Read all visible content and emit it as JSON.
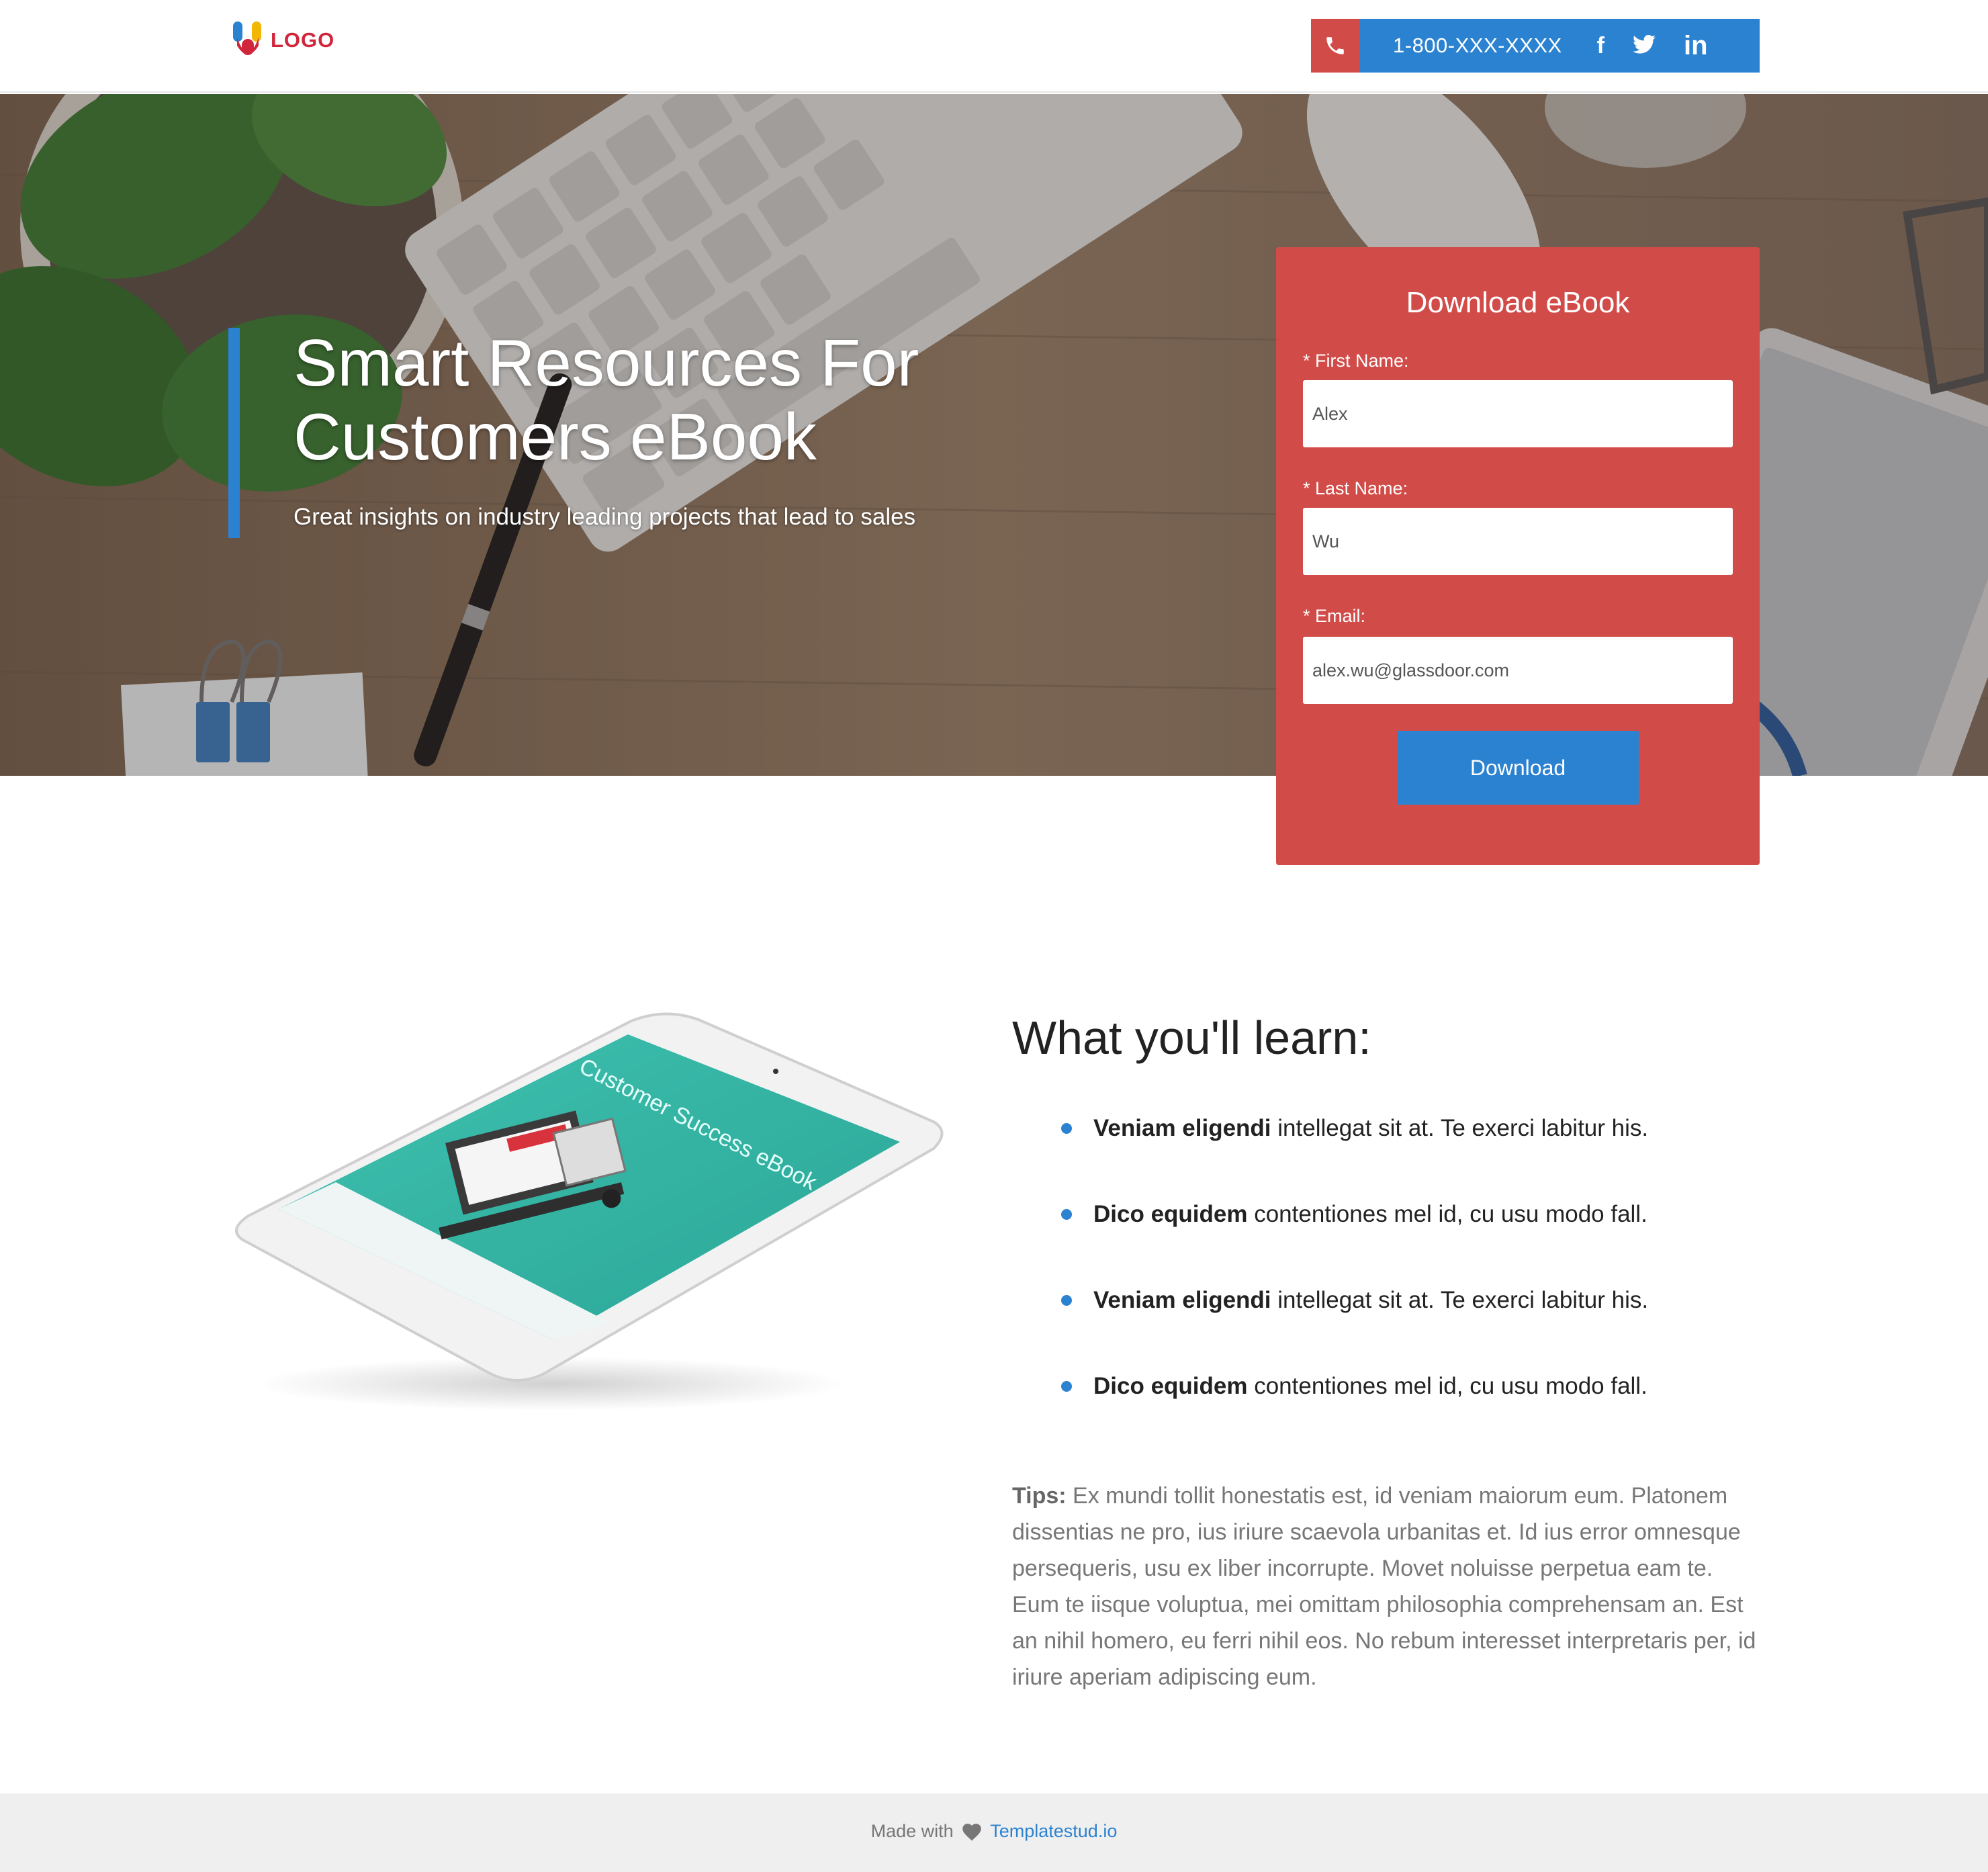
{
  "header": {
    "logo_text": "LOGO",
    "phone": "1-800-XXX-XXXX",
    "social": {
      "facebook": "f",
      "linkedin": "in"
    }
  },
  "hero": {
    "title": "Smart Resources For Customers eBook",
    "subtitle": "Great insights on industry leading projects that lead to sales"
  },
  "form": {
    "title": "Download eBook",
    "first_name_label": "* First Name:",
    "first_name_value": "Alex",
    "last_name_label": "* Last Name:",
    "last_name_value": "Wu",
    "email_label": "* Email:",
    "email_value": "alex.wu@glassdoor.com",
    "button_label": "Download"
  },
  "content": {
    "tablet_screen_text": "Customer Success eBook",
    "learn_title": "What you'll learn:",
    "items": [
      {
        "bold": "Veniam eligendi",
        "text": " intellegat sit at. Te exerci labitur his."
      },
      {
        "bold": "Dico equidem",
        "text": " contentiones mel id, cu usu modo fall."
      },
      {
        "bold": "Veniam eligendi",
        "text": " intellegat sit at. Te exerci labitur his."
      },
      {
        "bold": "Dico equidem",
        "text": " contentiones mel id, cu usu modo fall."
      }
    ],
    "tips_label": "Tips:",
    "tips_text": " Ex mundi tollit honestatis est, id veniam maiorum eum. Platonem dissentias ne pro, ius iriure scaevola urbanitas et. Id ius error omnesque persequeris, usu ex liber incorrupte. Movet noluisse perpetua eam te. Eum te iisque voluptua, mei omittam philosophia comprehensam an. Est an nihil homero, eu ferri nihil eos. No rebum interesset interpretaris per, id iriure aperiam adipiscing eum."
  },
  "footer": {
    "made_with": "Made with",
    "link": "Templatestud.io"
  },
  "colors": {
    "accent_blue": "#2b82d1",
    "accent_red": "#d14b48",
    "logo_red": "#d0253a"
  },
  "icons": [
    "phone-icon",
    "facebook-icon",
    "twitter-icon",
    "linkedin-icon",
    "heart-icon"
  ]
}
